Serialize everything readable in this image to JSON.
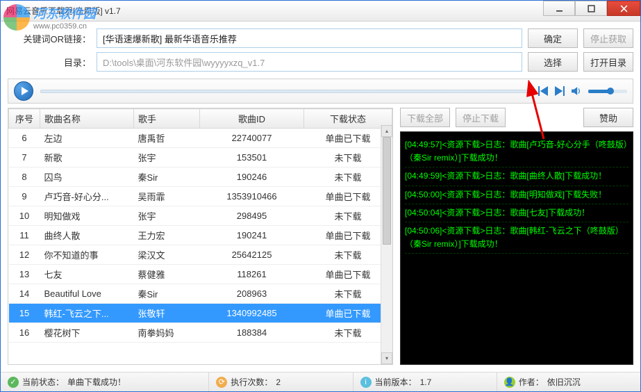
{
  "watermark": {
    "name": "河东软件园",
    "url": "www.pc0359.cn"
  },
  "window": {
    "title": "网易云音乐下载器[自用版] v1.7"
  },
  "form": {
    "keyword_label": "关键词OR链接：",
    "keyword_value": "[华语速爆新歌] 最新华语音乐推荐",
    "confirm_btn": "确定",
    "stop_fetch_btn": "停止获取",
    "dir_label": "目录：",
    "dir_value": "D:\\tools\\桌面\\河东软件园\\wyyyyxzq_v1.7",
    "select_btn": "选择",
    "open_dir_btn": "打开目录"
  },
  "table": {
    "headers": [
      "序号",
      "歌曲名称",
      "歌手",
      "歌曲ID",
      "下载状态"
    ],
    "rows": [
      {
        "n": "6",
        "name": "左边",
        "artist": "唐禹哲",
        "id": "22740077",
        "status": "单曲已下载",
        "sel": false
      },
      {
        "n": "7",
        "name": "新歌",
        "artist": "张宇",
        "id": "153501",
        "status": "未下载",
        "sel": false
      },
      {
        "n": "8",
        "name": "囚鸟",
        "artist": "秦Sir",
        "id": "190246",
        "status": "未下载",
        "sel": false
      },
      {
        "n": "9",
        "name": "卢巧音-好心分...",
        "artist": "吴雨霏",
        "id": "1353910466",
        "status": "单曲已下载",
        "sel": false
      },
      {
        "n": "10",
        "name": "明知做戏",
        "artist": "张宇",
        "id": "298495",
        "status": "未下载",
        "sel": false
      },
      {
        "n": "11",
        "name": "曲终人散",
        "artist": "王力宏",
        "id": "190241",
        "status": "单曲已下载",
        "sel": false
      },
      {
        "n": "12",
        "name": "你不知道的事",
        "artist": "梁汉文",
        "id": "25642125",
        "status": "未下载",
        "sel": false
      },
      {
        "n": "13",
        "name": "七友",
        "artist": "蔡健雅",
        "id": "118261",
        "status": "单曲已下载",
        "sel": false
      },
      {
        "n": "14",
        "name": "Beautiful Love",
        "artist": "秦Sir",
        "id": "208963",
        "status": "未下载",
        "sel": false
      },
      {
        "n": "15",
        "name": "韩红-飞云之下...",
        "artist": "张敬轩",
        "id": "1340992485",
        "status": "单曲已下载",
        "sel": true
      },
      {
        "n": "16",
        "name": "樱花树下",
        "artist": "南拳妈妈",
        "id": "188384",
        "status": "未下载",
        "sel": false
      }
    ]
  },
  "right_buttons": {
    "download_all": "下载全部",
    "stop_download": "停止下载",
    "donate": "赞助"
  },
  "logs": [
    "[04:49:57]<资源下载>日志：歌曲[卢巧音-好心分手（咚鼓版）（秦Sir remix）]下载成功！",
    "[04:49:59]<资源下载>日志：歌曲[曲终人散]下载成功！",
    "[04:50:00]<资源下载>日志：歌曲[明知做戏]下载失败！",
    "[04:50:04]<资源下载>日志：歌曲[七友]下载成功！",
    "[04:50:06]<资源下载>日志：歌曲[韩红-飞云之下（咚鼓版）（秦Sir remix）]下载成功！"
  ],
  "statusbar": {
    "state_label": "当前状态：",
    "state_value": "单曲下载成功！",
    "count_label": "执行次数：",
    "count_value": "2",
    "version_label": "当前版本：",
    "version_value": "1.7",
    "author_label": "作者：",
    "author_value": "依旧沉沉"
  }
}
